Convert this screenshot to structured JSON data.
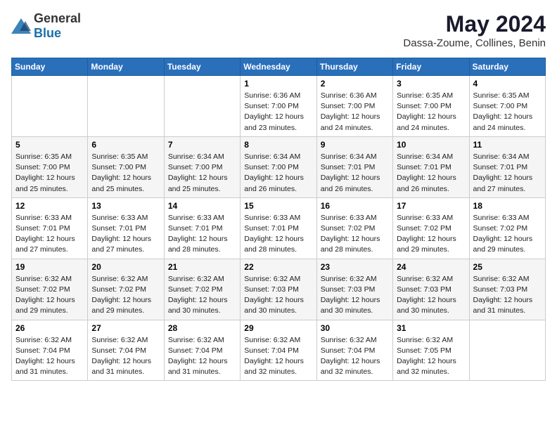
{
  "logo": {
    "general": "General",
    "blue": "Blue"
  },
  "header": {
    "month": "May 2024",
    "location": "Dassa-Zoume, Collines, Benin"
  },
  "weekdays": [
    "Sunday",
    "Monday",
    "Tuesday",
    "Wednesday",
    "Thursday",
    "Friday",
    "Saturday"
  ],
  "weeks": [
    [
      {
        "day": "",
        "sunrise": "",
        "sunset": "",
        "daylight": ""
      },
      {
        "day": "",
        "sunrise": "",
        "sunset": "",
        "daylight": ""
      },
      {
        "day": "",
        "sunrise": "",
        "sunset": "",
        "daylight": ""
      },
      {
        "day": "1",
        "sunrise": "Sunrise: 6:36 AM",
        "sunset": "Sunset: 7:00 PM",
        "daylight": "Daylight: 12 hours and 23 minutes."
      },
      {
        "day": "2",
        "sunrise": "Sunrise: 6:36 AM",
        "sunset": "Sunset: 7:00 PM",
        "daylight": "Daylight: 12 hours and 24 minutes."
      },
      {
        "day": "3",
        "sunrise": "Sunrise: 6:35 AM",
        "sunset": "Sunset: 7:00 PM",
        "daylight": "Daylight: 12 hours and 24 minutes."
      },
      {
        "day": "4",
        "sunrise": "Sunrise: 6:35 AM",
        "sunset": "Sunset: 7:00 PM",
        "daylight": "Daylight: 12 hours and 24 minutes."
      }
    ],
    [
      {
        "day": "5",
        "sunrise": "Sunrise: 6:35 AM",
        "sunset": "Sunset: 7:00 PM",
        "daylight": "Daylight: 12 hours and 25 minutes."
      },
      {
        "day": "6",
        "sunrise": "Sunrise: 6:35 AM",
        "sunset": "Sunset: 7:00 PM",
        "daylight": "Daylight: 12 hours and 25 minutes."
      },
      {
        "day": "7",
        "sunrise": "Sunrise: 6:34 AM",
        "sunset": "Sunset: 7:00 PM",
        "daylight": "Daylight: 12 hours and 25 minutes."
      },
      {
        "day": "8",
        "sunrise": "Sunrise: 6:34 AM",
        "sunset": "Sunset: 7:00 PM",
        "daylight": "Daylight: 12 hours and 26 minutes."
      },
      {
        "day": "9",
        "sunrise": "Sunrise: 6:34 AM",
        "sunset": "Sunset: 7:01 PM",
        "daylight": "Daylight: 12 hours and 26 minutes."
      },
      {
        "day": "10",
        "sunrise": "Sunrise: 6:34 AM",
        "sunset": "Sunset: 7:01 PM",
        "daylight": "Daylight: 12 hours and 26 minutes."
      },
      {
        "day": "11",
        "sunrise": "Sunrise: 6:34 AM",
        "sunset": "Sunset: 7:01 PM",
        "daylight": "Daylight: 12 hours and 27 minutes."
      }
    ],
    [
      {
        "day": "12",
        "sunrise": "Sunrise: 6:33 AM",
        "sunset": "Sunset: 7:01 PM",
        "daylight": "Daylight: 12 hours and 27 minutes."
      },
      {
        "day": "13",
        "sunrise": "Sunrise: 6:33 AM",
        "sunset": "Sunset: 7:01 PM",
        "daylight": "Daylight: 12 hours and 27 minutes."
      },
      {
        "day": "14",
        "sunrise": "Sunrise: 6:33 AM",
        "sunset": "Sunset: 7:01 PM",
        "daylight": "Daylight: 12 hours and 28 minutes."
      },
      {
        "day": "15",
        "sunrise": "Sunrise: 6:33 AM",
        "sunset": "Sunset: 7:01 PM",
        "daylight": "Daylight: 12 hours and 28 minutes."
      },
      {
        "day": "16",
        "sunrise": "Sunrise: 6:33 AM",
        "sunset": "Sunset: 7:02 PM",
        "daylight": "Daylight: 12 hours and 28 minutes."
      },
      {
        "day": "17",
        "sunrise": "Sunrise: 6:33 AM",
        "sunset": "Sunset: 7:02 PM",
        "daylight": "Daylight: 12 hours and 29 minutes."
      },
      {
        "day": "18",
        "sunrise": "Sunrise: 6:33 AM",
        "sunset": "Sunset: 7:02 PM",
        "daylight": "Daylight: 12 hours and 29 minutes."
      }
    ],
    [
      {
        "day": "19",
        "sunrise": "Sunrise: 6:32 AM",
        "sunset": "Sunset: 7:02 PM",
        "daylight": "Daylight: 12 hours and 29 minutes."
      },
      {
        "day": "20",
        "sunrise": "Sunrise: 6:32 AM",
        "sunset": "Sunset: 7:02 PM",
        "daylight": "Daylight: 12 hours and 29 minutes."
      },
      {
        "day": "21",
        "sunrise": "Sunrise: 6:32 AM",
        "sunset": "Sunset: 7:02 PM",
        "daylight": "Daylight: 12 hours and 30 minutes."
      },
      {
        "day": "22",
        "sunrise": "Sunrise: 6:32 AM",
        "sunset": "Sunset: 7:03 PM",
        "daylight": "Daylight: 12 hours and 30 minutes."
      },
      {
        "day": "23",
        "sunrise": "Sunrise: 6:32 AM",
        "sunset": "Sunset: 7:03 PM",
        "daylight": "Daylight: 12 hours and 30 minutes."
      },
      {
        "day": "24",
        "sunrise": "Sunrise: 6:32 AM",
        "sunset": "Sunset: 7:03 PM",
        "daylight": "Daylight: 12 hours and 30 minutes."
      },
      {
        "day": "25",
        "sunrise": "Sunrise: 6:32 AM",
        "sunset": "Sunset: 7:03 PM",
        "daylight": "Daylight: 12 hours and 31 minutes."
      }
    ],
    [
      {
        "day": "26",
        "sunrise": "Sunrise: 6:32 AM",
        "sunset": "Sunset: 7:04 PM",
        "daylight": "Daylight: 12 hours and 31 minutes."
      },
      {
        "day": "27",
        "sunrise": "Sunrise: 6:32 AM",
        "sunset": "Sunset: 7:04 PM",
        "daylight": "Daylight: 12 hours and 31 minutes."
      },
      {
        "day": "28",
        "sunrise": "Sunrise: 6:32 AM",
        "sunset": "Sunset: 7:04 PM",
        "daylight": "Daylight: 12 hours and 31 minutes."
      },
      {
        "day": "29",
        "sunrise": "Sunrise: 6:32 AM",
        "sunset": "Sunset: 7:04 PM",
        "daylight": "Daylight: 12 hours and 32 minutes."
      },
      {
        "day": "30",
        "sunrise": "Sunrise: 6:32 AM",
        "sunset": "Sunset: 7:04 PM",
        "daylight": "Daylight: 12 hours and 32 minutes."
      },
      {
        "day": "31",
        "sunrise": "Sunrise: 6:32 AM",
        "sunset": "Sunset: 7:05 PM",
        "daylight": "Daylight: 12 hours and 32 minutes."
      },
      {
        "day": "",
        "sunrise": "",
        "sunset": "",
        "daylight": ""
      }
    ]
  ]
}
